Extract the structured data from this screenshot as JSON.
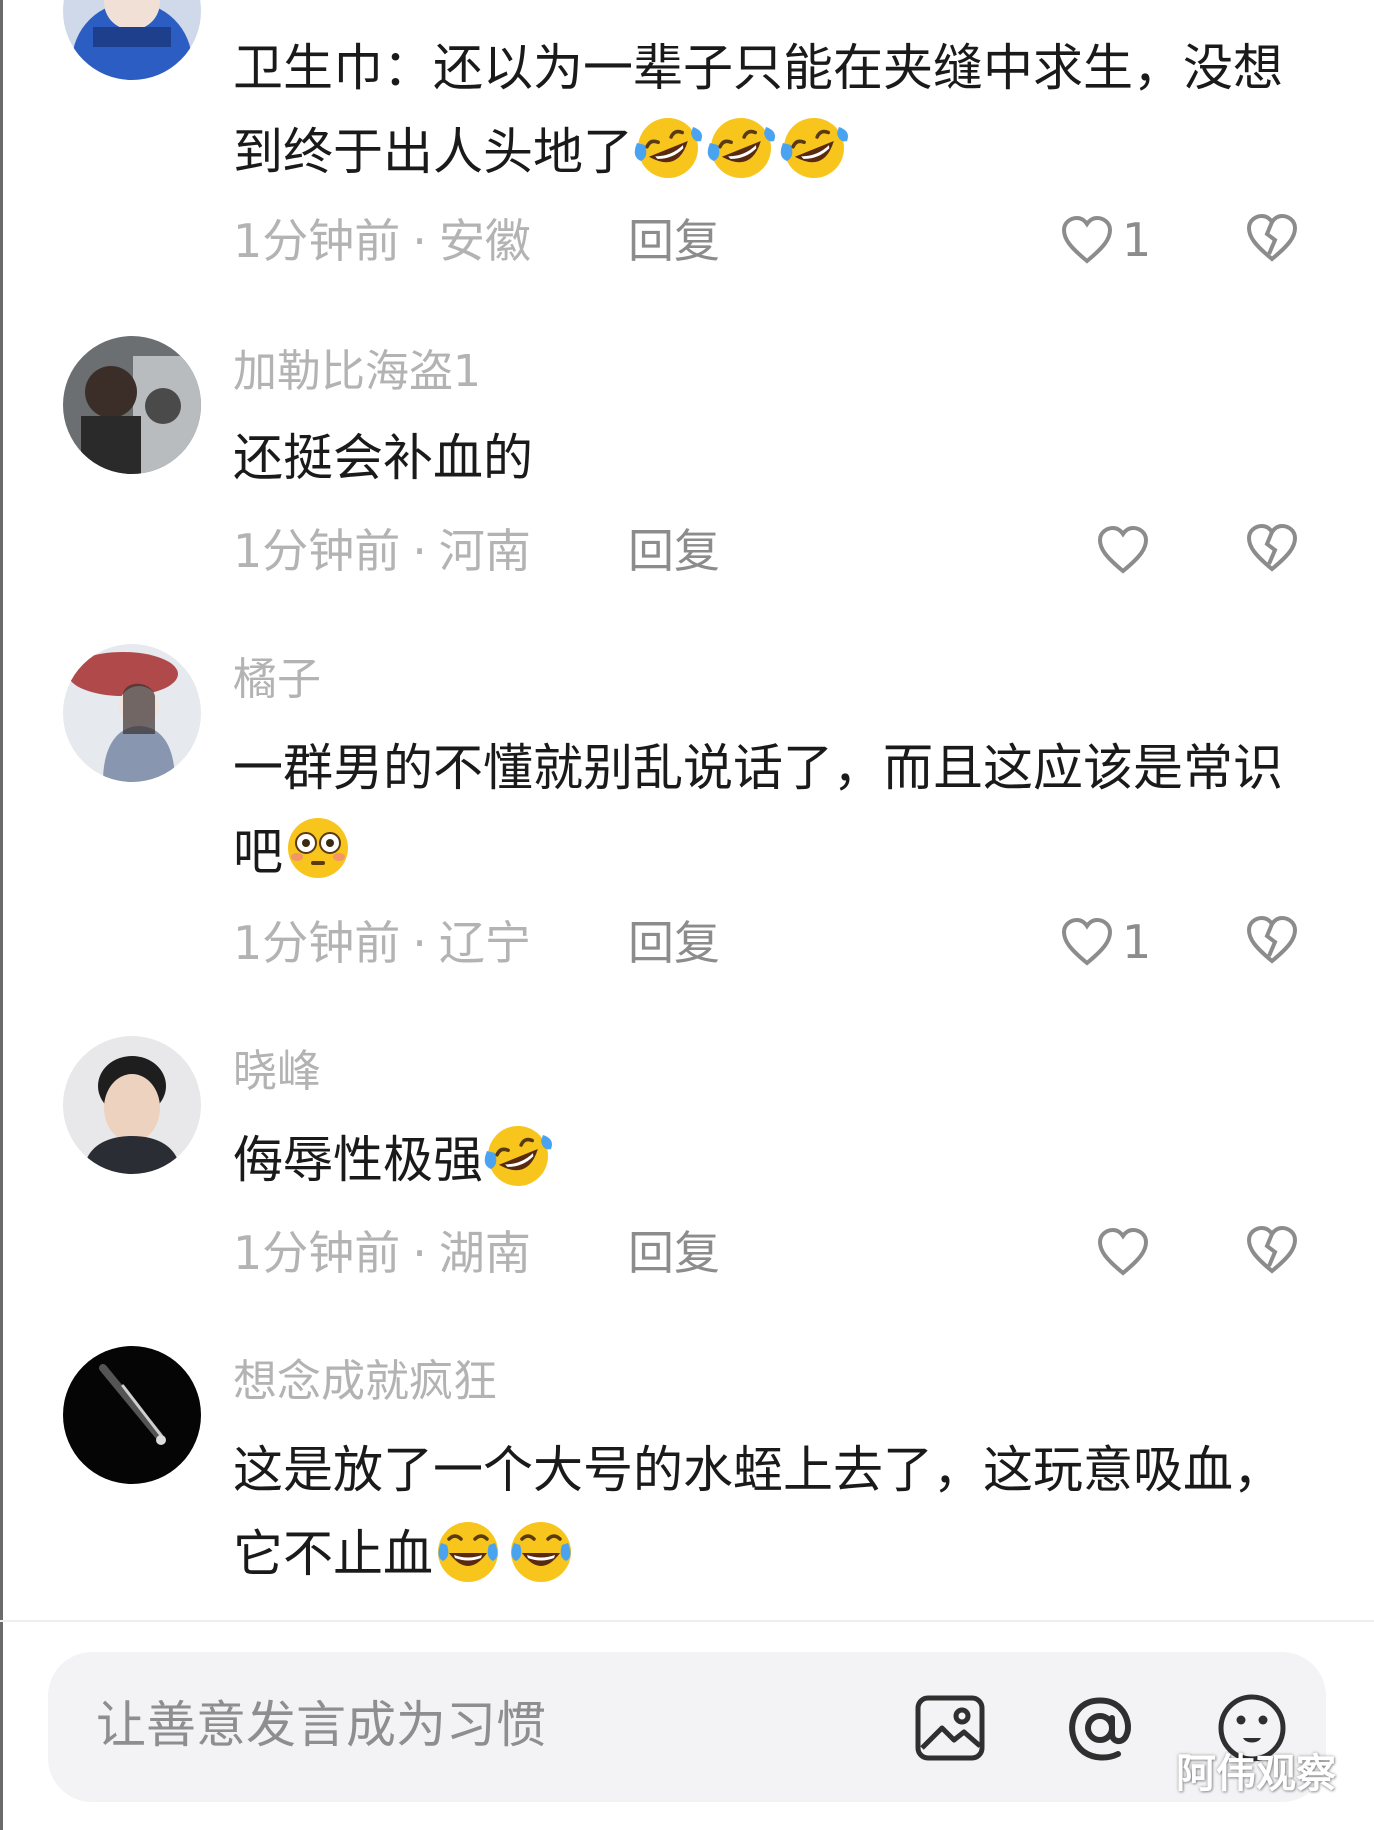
{
  "comments": [
    {
      "username": "",
      "text": "卫生巾：还以为一辈子只能在夹缝中求生，没想到终于出人头地了",
      "emoji_count": 3,
      "emoji_type": "rofl",
      "time": "1分钟前",
      "location": "安徽",
      "reply_label": "回复",
      "like_count": "1"
    },
    {
      "username": "加勒比海盗1",
      "text": "还挺会补血的",
      "emoji_count": 0,
      "emoji_type": "",
      "time": "1分钟前",
      "location": "河南",
      "reply_label": "回复",
      "like_count": ""
    },
    {
      "username": "橘子",
      "text": "一群男的不懂就别乱说话了，而且这应该是常识吧",
      "emoji_count": 1,
      "emoji_type": "flushed",
      "time": "1分钟前",
      "location": "辽宁",
      "reply_label": "回复",
      "like_count": "1"
    },
    {
      "username": "晓峰",
      "text": "侮辱性极强",
      "emoji_count": 1,
      "emoji_type": "rofl",
      "time": "1分钟前",
      "location": "湖南",
      "reply_label": "回复",
      "like_count": ""
    },
    {
      "username": "想念成就疯狂",
      "text": "这是放了一个大号的水蛭上去了，这玩意吸血，它不止血",
      "emoji_count": 2,
      "emoji_type": "joy",
      "time": "",
      "location": "",
      "reply_label": "",
      "like_count": ""
    }
  ],
  "separator": "·",
  "input": {
    "placeholder": "让善意发言成为习惯"
  },
  "icons": {
    "like": "heart-outline-icon",
    "dislike": "broken-heart-icon",
    "image": "image-icon",
    "mention": "at-icon",
    "emoji": "emoji-face-icon"
  },
  "colors": {
    "text": "#1a1a1a",
    "muted": "#b3b3b3",
    "icon": "#8c8c8c",
    "input_bg": "#f3f3f5",
    "emoji_yellow": "#f7c51c",
    "emoji_blue": "#4aa3f0"
  },
  "watermark": "阿伟观察"
}
